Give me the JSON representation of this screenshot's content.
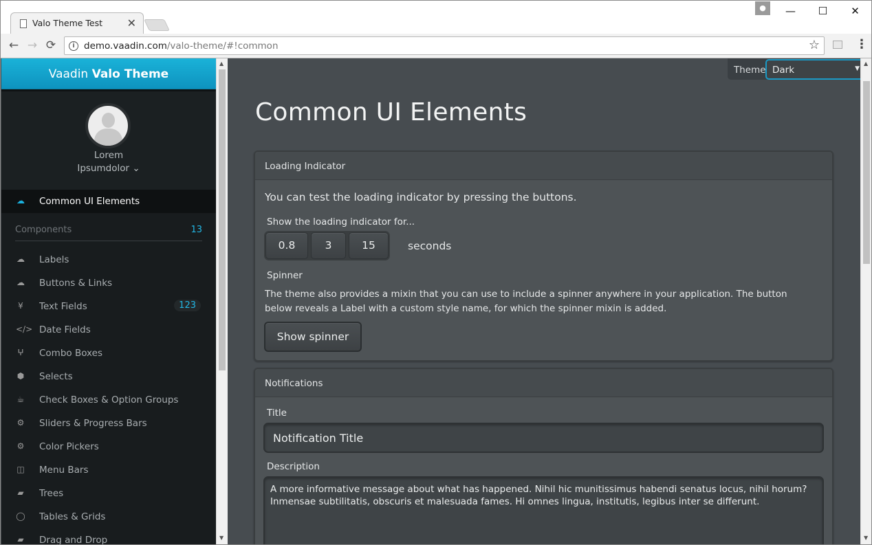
{
  "browser": {
    "tab_title": "Valo Theme Test",
    "tab_close": "✕",
    "url_host": "demo.vaadin.com",
    "url_path": "/valo-theme/#!common",
    "minimize": "—",
    "maximize": "☐",
    "close": "✕",
    "back": "←",
    "forward": "→",
    "reload": "⟳",
    "star": "☆",
    "menu": "⋮"
  },
  "sidebar": {
    "brand_prefix": "Vaadin",
    "brand_bold": "Valo Theme",
    "user_first": "Lorem",
    "user_last": "Ipsumdolor ⌄",
    "active_item": {
      "label": "Common UI Elements",
      "icon": "cloud-icon"
    },
    "section": {
      "label": "Components",
      "count": "13"
    },
    "items": [
      {
        "label": "Labels",
        "icon": "cloud-download-icon",
        "glyph": "☁"
      },
      {
        "label": "Buttons & Links",
        "icon": "cloud-upload-icon",
        "glyph": "☁"
      },
      {
        "label": "Text Fields",
        "icon": "yen-icon",
        "glyph": "¥",
        "badge": "123"
      },
      {
        "label": "Date Fields",
        "icon": "code-icon",
        "glyph": "</>"
      },
      {
        "label": "Combo Boxes",
        "icon": "code-fork-icon",
        "glyph": "ⵖ"
      },
      {
        "label": "Selects",
        "icon": "cube-icon",
        "glyph": "⬢"
      },
      {
        "label": "Check Boxes & Option Groups",
        "icon": "coffee-icon",
        "glyph": "☕"
      },
      {
        "label": "Sliders & Progress Bars",
        "icon": "cog-icon",
        "glyph": "⚙"
      },
      {
        "label": "Color Pickers",
        "icon": "cogs-icon",
        "glyph": "⚙"
      },
      {
        "label": "Menu Bars",
        "icon": "columns-icon",
        "glyph": "◫"
      },
      {
        "label": "Trees",
        "icon": "comment-icon",
        "glyph": "▰"
      },
      {
        "label": "Tables & Grids",
        "icon": "comment-o-icon",
        "glyph": "◯"
      },
      {
        "label": "Drag and Drop",
        "icon": "comments-icon",
        "glyph": "▰"
      }
    ]
  },
  "theme": {
    "label": "Theme:",
    "value": "Dark",
    "arrow": "▼"
  },
  "main": {
    "title": "Common UI Elements",
    "loading": {
      "header": "Loading Indicator",
      "intro": "You can test the loading indicator by pressing the buttons.",
      "caption": "Show the loading indicator for...",
      "buttons": [
        "0.8",
        "3",
        "15"
      ],
      "unit": "seconds",
      "spinner_caption": "Spinner",
      "spinner_text": "The theme also provides a mixin that you can use to include a spinner anywhere in your application. The button below reveals a Label with a custom style name, for which the spinner mixin is added.",
      "spinner_button": "Show spinner"
    },
    "notifications": {
      "header": "Notifications",
      "title_caption": "Title",
      "title_value": "Notification Title",
      "desc_caption": "Description",
      "desc_value": "A more informative message about what has happened. Nihil hic munitissimus habendi senatus locus, nihil horum? Inmensae subtilitatis, obscuris et malesuada fames. Hi omnes lingua, institutis, legibus inter se differunt."
    }
  }
}
